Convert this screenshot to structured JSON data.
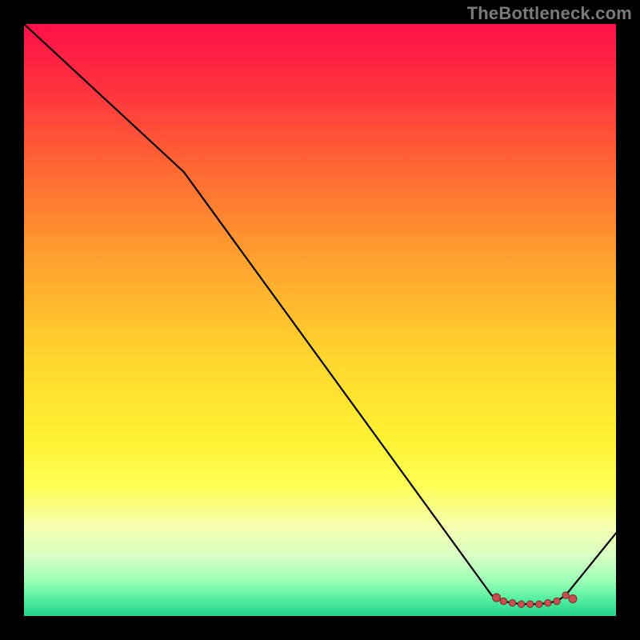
{
  "watermark": "TheBottleneck.com",
  "chart_data": {
    "type": "line",
    "title": "",
    "xlabel": "",
    "ylabel": "",
    "xlim": [
      0,
      100
    ],
    "ylim": [
      0,
      100
    ],
    "x": [
      0,
      27,
      79,
      81,
      82.5,
      84,
      85.5,
      87,
      88.5,
      90,
      91.5,
      100
    ],
    "values": [
      100,
      75,
      3.5,
      2.5,
      2.2,
      2.0,
      2.0,
      2.0,
      2.2,
      2.5,
      3.5,
      14
    ],
    "markers": {
      "x": [
        81,
        82.5,
        84,
        85.5,
        87,
        88.5,
        90,
        91.5
      ],
      "y": [
        2.5,
        2.2,
        2.0,
        2.0,
        2.0,
        2.2,
        2.5,
        3.5
      ],
      "edge_dashed": true
    },
    "gradient_stops": [
      {
        "offset": 0.0,
        "color": "#ff1048"
      },
      {
        "offset": 0.1,
        "color": "#ff2f3f"
      },
      {
        "offset": 0.25,
        "color": "#ff6a33"
      },
      {
        "offset": 0.4,
        "color": "#ffa22f"
      },
      {
        "offset": 0.55,
        "color": "#ffd22e"
      },
      {
        "offset": 0.7,
        "color": "#fff233"
      },
      {
        "offset": 0.78,
        "color": "#ffff55"
      },
      {
        "offset": 0.85,
        "color": "#f5ffb0"
      },
      {
        "offset": 0.9,
        "color": "#d6ffc4"
      },
      {
        "offset": 0.94,
        "color": "#9dffb6"
      },
      {
        "offset": 0.97,
        "color": "#57f0a0"
      },
      {
        "offset": 1.0,
        "color": "#22d18a"
      }
    ],
    "line_color": "#000000",
    "marker_fill": "#c94f4f",
    "marker_stroke": "#7a2b2b"
  }
}
